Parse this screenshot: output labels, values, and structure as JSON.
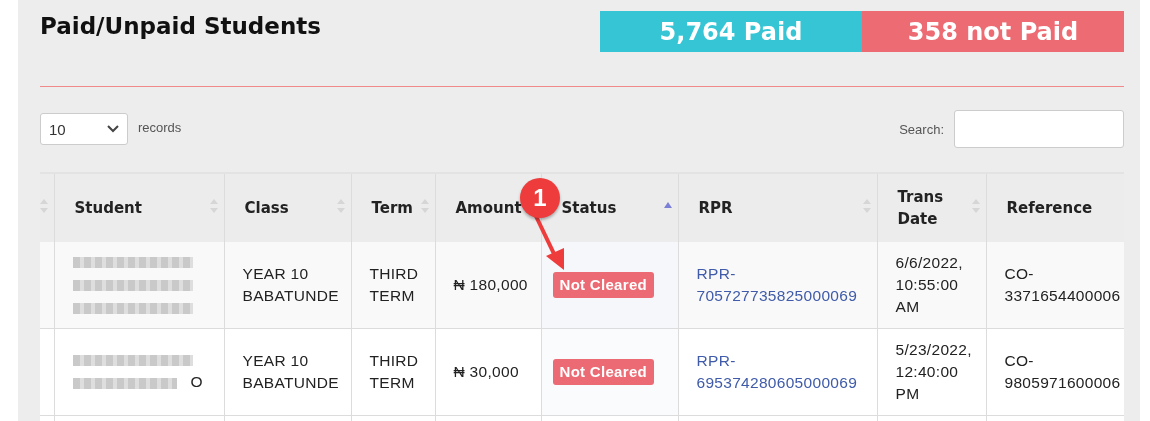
{
  "title": "Paid/Unpaid Students",
  "stats": [
    {
      "label": "5,764 Paid",
      "kind": "paid"
    },
    {
      "label": "358 not Paid",
      "kind": "unpaid"
    }
  ],
  "length_menu": {
    "value": "10",
    "label": "records"
  },
  "search": {
    "label": "Search:"
  },
  "table": {
    "columns": [
      {
        "sortable": true,
        "sorted": false
      },
      {
        "label": "Student",
        "sortable": true,
        "sorted": false
      },
      {
        "label": "Class",
        "sortable": true,
        "sorted": false
      },
      {
        "label": "Term",
        "sortable": true,
        "sorted": false
      },
      {
        "label": "Amount"
      },
      {
        "label": "Status",
        "sortable": true,
        "sorted": true
      },
      {
        "label": "RPR",
        "sortable": true,
        "sorted": false
      },
      {
        "label": "Trans Date",
        "sortable": true,
        "sorted": false
      },
      {
        "label": "Reference"
      }
    ],
    "rows": [
      {
        "student": {
          "redacted": true
        },
        "class": "YEAR 10 BABATUNDE",
        "term": "THIRD TERM",
        "amount": "₦ 180,000",
        "status": "Not Cleared",
        "rpr": "RPR-705727735825000069",
        "trans_date": "6/6/2022, 10:55:00 AM",
        "reference": "CO-3371654400006"
      },
      {
        "student": {
          "redacted": true,
          "visible_tail": "O"
        },
        "class": "YEAR 10 BABATUNDE",
        "term": "THIRD TERM",
        "amount": "₦ 30,000",
        "status": "Not Cleared",
        "rpr": "RPR-695374280605000069",
        "trans_date": "5/23/2022, 12:40:00 PM",
        "reference": "CO-9805971600006"
      }
    ]
  },
  "annotation": {
    "number": "1"
  }
}
